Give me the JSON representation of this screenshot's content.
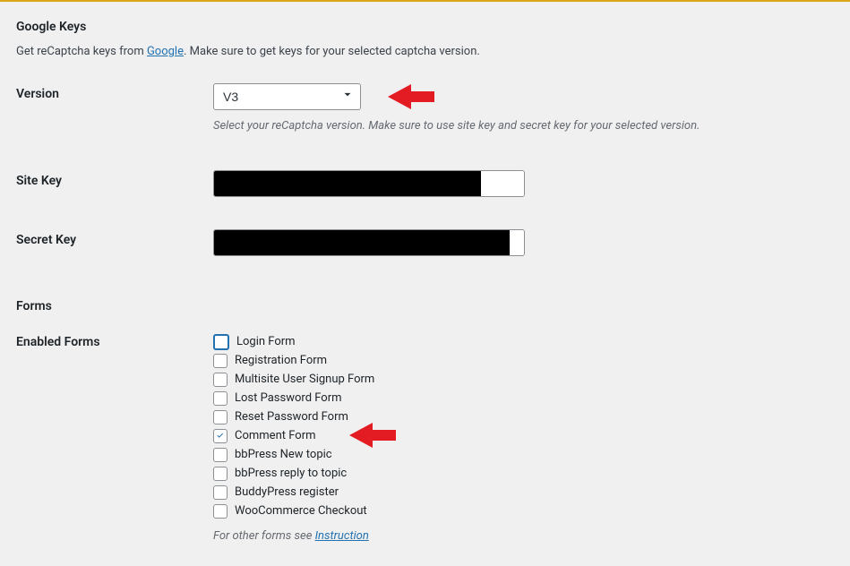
{
  "googleKeys": {
    "title": "Google Keys",
    "desc_prefix": "Get reCaptcha keys from ",
    "link_text": "Google",
    "desc_suffix": ". Make sure to get keys for your selected captcha version."
  },
  "version": {
    "label": "Version",
    "selected": "V3",
    "hint": "Select your reCaptcha version. Make sure to use site key and secret key for your selected version."
  },
  "siteKey": {
    "label": "Site Key",
    "value": ""
  },
  "secretKey": {
    "label": "Secret Key",
    "value": ""
  },
  "forms": {
    "title": "Forms",
    "enabled_label": "Enabled Forms",
    "items": [
      {
        "label": "Login Form",
        "checked": false,
        "focused": true
      },
      {
        "label": "Registration Form",
        "checked": false,
        "focused": false
      },
      {
        "label": "Multisite User Signup Form",
        "checked": false,
        "focused": false
      },
      {
        "label": "Lost Password Form",
        "checked": false,
        "focused": false
      },
      {
        "label": "Reset Password Form",
        "checked": false,
        "focused": false
      },
      {
        "label": "Comment Form",
        "checked": true,
        "focused": false
      },
      {
        "label": "bbPress New topic",
        "checked": false,
        "focused": false
      },
      {
        "label": "bbPress reply to topic",
        "checked": false,
        "focused": false
      },
      {
        "label": "BuddyPress register",
        "checked": false,
        "focused": false
      },
      {
        "label": "WooCommerce Checkout",
        "checked": false,
        "focused": false
      }
    ],
    "hint_prefix": "For other forms see ",
    "hint_link": "Instruction"
  },
  "colors": {
    "arrow": "#e31b23"
  }
}
